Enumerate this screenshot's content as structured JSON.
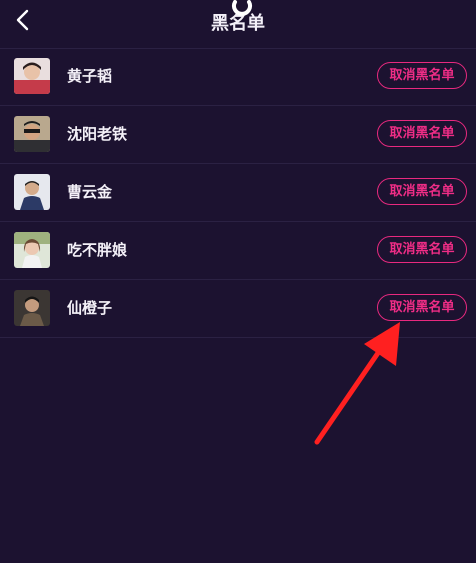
{
  "header": {
    "title": "黑名单",
    "back_icon": "chevron-left-icon",
    "loading_icon": "refresh-icon"
  },
  "blacklist": {
    "items": [
      {
        "name": "黄子韬",
        "action_label": "取消黑名单",
        "avatar_color": "#cfa6a6"
      },
      {
        "name": "沈阳老铁",
        "action_label": "取消黑名单",
        "avatar_color": "#8a7a6a"
      },
      {
        "name": "曹云金",
        "action_label": "取消黑名单",
        "avatar_color": "#4a5a7a"
      },
      {
        "name": "吃不胖娘",
        "action_label": "取消黑名单",
        "avatar_color": "#c8c0b0"
      },
      {
        "name": "仙橙子",
        "action_label": "取消黑名单",
        "avatar_color": "#3a3a3a"
      }
    ]
  },
  "colors": {
    "background": "#1c1230",
    "accent": "#e8297f",
    "divider": "#2b2143",
    "annotation_arrow": "#ff2020"
  }
}
